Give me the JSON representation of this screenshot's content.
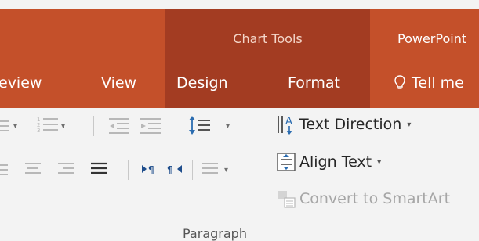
{
  "title_bar": {
    "contextual_group": "Chart Tools",
    "app_name": "PowerPoint"
  },
  "tabs": [
    {
      "label": "eview"
    },
    {
      "label": "View"
    },
    {
      "label": "Design"
    },
    {
      "label": "Format"
    }
  ],
  "tell_me": {
    "label": "Tell me",
    "icon": "lightbulb-icon"
  },
  "ribbon": {
    "commands": {
      "text_direction": "Text Direction",
      "align_text": "Align Text",
      "convert_smartart": "Convert to SmartArt"
    },
    "dropdown_caret": "▾",
    "group_label": "Paragraph"
  },
  "colors": {
    "ribbon_accent": "#c4502a",
    "contextual_tab": "#a33c22",
    "ribbon_body": "#f3f3f3",
    "icon_blue": "#2b6cb0"
  }
}
